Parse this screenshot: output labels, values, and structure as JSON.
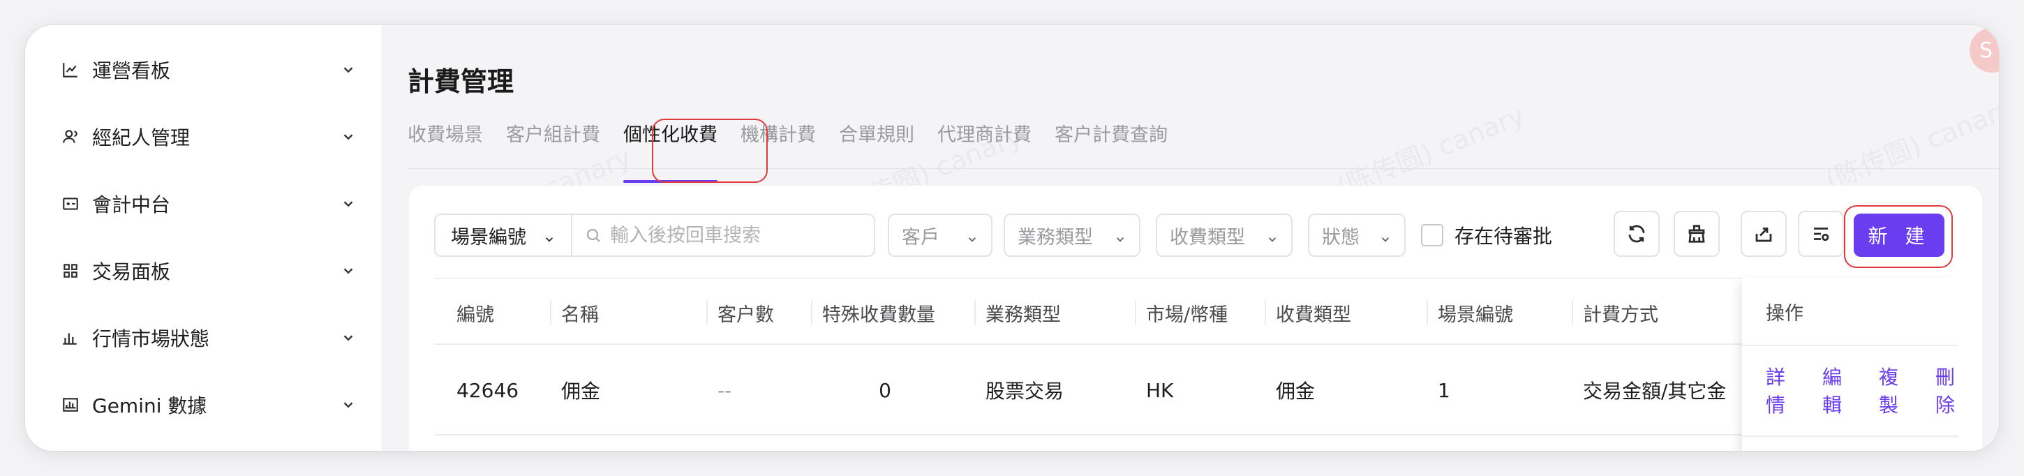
{
  "sidebar": {
    "items": [
      {
        "label": "運營看板",
        "icon": "line-chart-icon"
      },
      {
        "label": "經紀人管理",
        "icon": "user-icon"
      },
      {
        "label": "會計中台",
        "icon": "ledger-icon"
      },
      {
        "label": "交易面板",
        "icon": "grid-icon"
      },
      {
        "label": "行情市場狀態",
        "icon": "bar-chart-icon"
      },
      {
        "label": "Gemini 數據",
        "icon": "data-chart-icon"
      }
    ]
  },
  "page": {
    "title": "計費管理",
    "tabs": [
      "收費場景",
      "客户組計費",
      "個性化收費",
      "機構計費",
      "合單規則",
      "代理商計費",
      "客户計費查詢"
    ],
    "active_tab": "個性化收費",
    "avatar_text": "S"
  },
  "filters": {
    "scene_select": "場景編號",
    "search_placeholder": "輸入後按回車搜索",
    "customer": "客戶",
    "business_type": "業務類型",
    "fee_type": "收費類型",
    "status": "狀態",
    "pending_checkbox": "存在待審批",
    "new_button": "新 建"
  },
  "table": {
    "headers": [
      "編號",
      "名稱",
      "客户數",
      "特殊收費數量",
      "業務類型",
      "市場/幣種",
      "收費類型",
      "場景編號",
      "計費方式",
      "操作"
    ],
    "rows": [
      {
        "id": "42646",
        "name": "佣金",
        "customers": "--",
        "special_count": "0",
        "business_type": "股票交易",
        "market": "HK",
        "fee_type": "佣金",
        "scene_no": "1",
        "billing": "交易金額/其它金"
      }
    ],
    "actions": [
      "詳情",
      "編輯",
      "複製",
      "刪除"
    ]
  },
  "watermark": "(陈传圆) canary",
  "colors": {
    "accent": "#6b3df0",
    "highlight": "#e23a3a"
  }
}
